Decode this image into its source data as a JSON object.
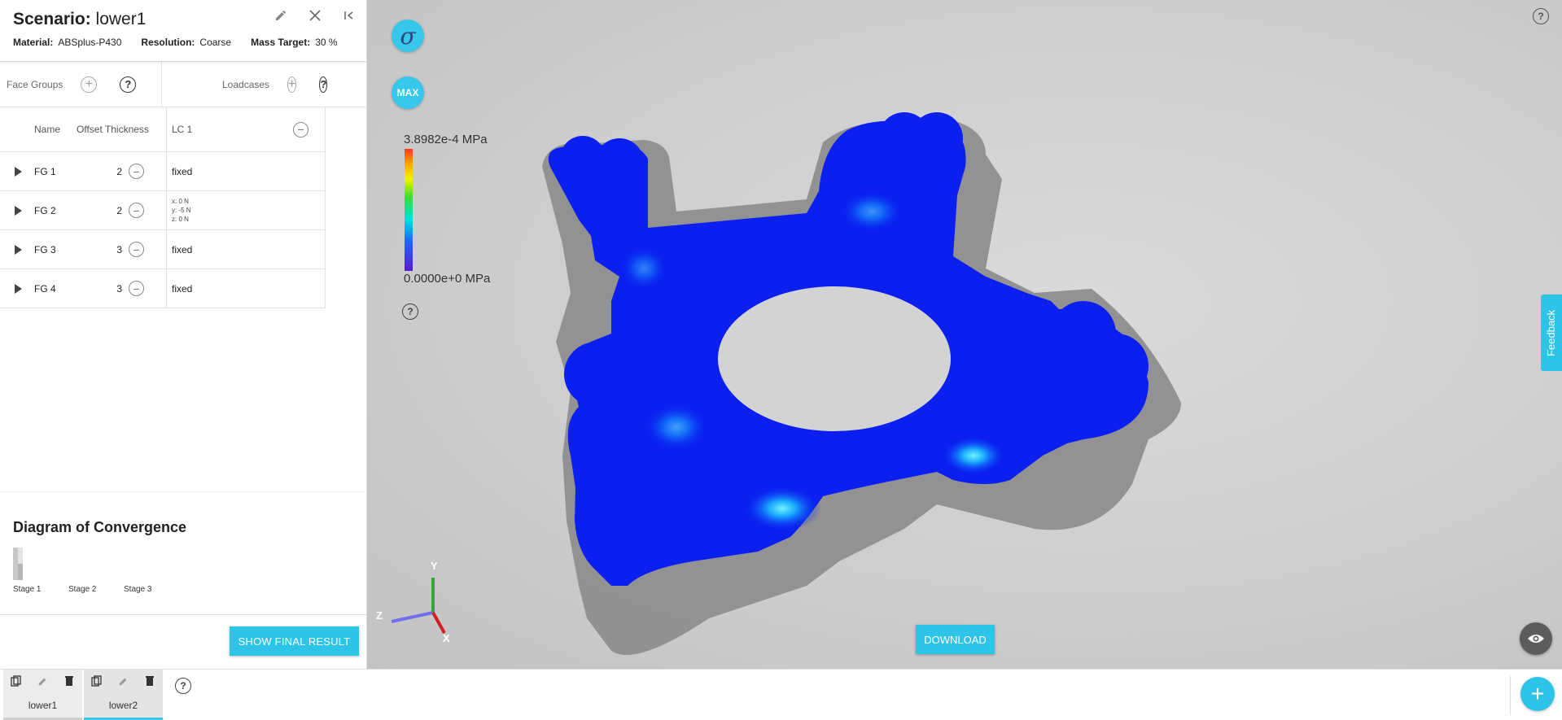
{
  "header": {
    "title_label": "Scenario:",
    "title_value": "lower1",
    "material_label": "Material:",
    "material_value": "ABSplus-P430",
    "resolution_label": "Resolution:",
    "resolution_value": "Coarse",
    "mass_label": "Mass Target:",
    "mass_value": "30 %"
  },
  "sections": {
    "face_groups": "Face Groups",
    "loadcases": "Loadcases",
    "plus_symbol": "+",
    "help_symbol": "?"
  },
  "table": {
    "col_name": "Name",
    "col_offset": "Offset Thickness",
    "col_lc": "LC 1",
    "minus_symbol": "−",
    "rows": [
      {
        "name": "FG 1",
        "offset": "2",
        "lc": "fixed"
      },
      {
        "name": "FG 2",
        "offset": "2",
        "lc_x": "x:  0 N",
        "lc_y": "y:  -5 N",
        "lc_z": "z:  0 N"
      },
      {
        "name": "FG 3",
        "offset": "3",
        "lc": "fixed"
      },
      {
        "name": "FG 4",
        "offset": "3",
        "lc": "fixed"
      }
    ]
  },
  "convergence": {
    "title": "Diagram of Convergence",
    "stages": [
      "Stage 1",
      "Stage 2",
      "Stage 3"
    ]
  },
  "buttons": {
    "show_final": "SHOW FINAL RESULT",
    "download": "DOWNLOAD",
    "sigma": "σ",
    "max": "MAX",
    "feedback": "Feedback",
    "add": "+"
  },
  "legend": {
    "max_value": "3.8982e-4 MPa",
    "min_value": "0.0000e+0 MPa"
  },
  "axes": {
    "x": "X",
    "y": "Y",
    "z": "Z"
  },
  "scenarios": [
    {
      "label": "lower1",
      "active": true
    },
    {
      "label": "lower2",
      "active": false
    }
  ],
  "colors": {
    "accent": "#2ec4e8",
    "model_blue": "#0a1ff0",
    "model_shadow": "#8e8e8e"
  }
}
